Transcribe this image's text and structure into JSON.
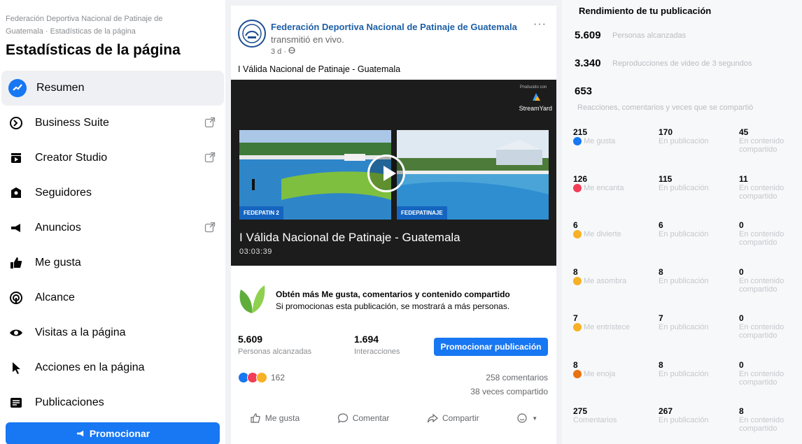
{
  "sidebar": {
    "breadcrumb": "Federación Deportiva Nacional de Patinaje de Guatemala · Estadísticas de la página",
    "title": "Estadísticas de la página",
    "items": [
      {
        "label": "Resumen",
        "icon": "chart-line-icon",
        "active": true
      },
      {
        "label": "Business Suite",
        "icon": "business-suite-icon",
        "external": true
      },
      {
        "label": "Creator Studio",
        "icon": "creator-studio-icon",
        "external": true
      },
      {
        "label": "Seguidores",
        "icon": "followers-icon"
      },
      {
        "label": "Anuncios",
        "icon": "megaphone-icon",
        "external": true
      },
      {
        "label": "Me gusta",
        "icon": "thumbs-up-icon"
      },
      {
        "label": "Alcance",
        "icon": "reach-icon"
      },
      {
        "label": "Visitas a la página",
        "icon": "eye-icon"
      },
      {
        "label": "Acciones en la página",
        "icon": "cursor-icon"
      },
      {
        "label": "Publicaciones",
        "icon": "posts-icon"
      }
    ],
    "promote_label": "Promocionar"
  },
  "post": {
    "page_name": "Federación Deportiva Nacional de Patinaje de Guatemala",
    "action": "transmitió en vivo.",
    "time": "3 d · ",
    "text": "I Válida Nacional de Patinaje - Guatemala",
    "video": {
      "produced_by": "Producido con",
      "brand": "StreamYard",
      "cam1_label": "FEDEPATIN 2",
      "cam2_label": "FEDEPATINAJE",
      "title": "I Válida Nacional de Patinaje - Guatemala",
      "duration": "03:03:39"
    },
    "promo": {
      "heading": "Obtén más Me gusta, comentarios y contenido compartido",
      "sub": "Si promocionas esta publicación, se mostrará a más personas."
    },
    "stats": {
      "reach_value": "5.609",
      "reach_label": "Personas alcanzadas",
      "inter_value": "1.694",
      "inter_label": "Interacciones"
    },
    "boost_label": "Promocionar publicación",
    "reaction_count": "162",
    "comments": "258 comentarios",
    "shares": "38 veces compartido",
    "actions": {
      "like": "Me gusta",
      "comment": "Comentar",
      "share": "Compartir"
    }
  },
  "performance": {
    "title": "Rendimiento de tu publicación",
    "reach": {
      "value": "5.609",
      "label": "Personas alcanzadas"
    },
    "views": {
      "value": "3.340",
      "label": "Reproducciones de video de 3 segundos"
    },
    "engagement": {
      "value": "653",
      "label": "Reacciones, comentarios y veces que se compartió"
    },
    "rows": [
      {
        "total": "215",
        "label": "Me gusta",
        "color": "#1877f2",
        "on_post": "170",
        "on_post_label": "En publicación",
        "on_shared": "45",
        "on_shared_label": "En contenido compartido"
      },
      {
        "total": "126",
        "label": "Me encanta",
        "color": "#f33e58",
        "on_post": "115",
        "on_post_label": "En publicación",
        "on_shared": "11",
        "on_shared_label": "En contenido compartido"
      },
      {
        "total": "6",
        "label": "Me divierte",
        "color": "#f7b125",
        "on_post": "6",
        "on_post_label": "En publicación",
        "on_shared": "0",
        "on_shared_label": "En contenido compartido"
      },
      {
        "total": "8",
        "label": "Me asombra",
        "color": "#f7b125",
        "on_post": "8",
        "on_post_label": "En publicación",
        "on_shared": "0",
        "on_shared_label": "En contenido compartido"
      },
      {
        "total": "7",
        "label": "Me entristece",
        "color": "#f7b125",
        "on_post": "7",
        "on_post_label": "En publicación",
        "on_shared": "0",
        "on_shared_label": "En contenido compartido"
      },
      {
        "total": "8",
        "label": "Me enoja",
        "color": "#e9710f",
        "on_post": "8",
        "on_post_label": "En publicación",
        "on_shared": "0",
        "on_shared_label": "En contenido compartido"
      },
      {
        "total": "275",
        "label": "Comentarios",
        "color": "",
        "on_post": "267",
        "on_post_label": "En publicación",
        "on_shared": "8",
        "on_shared_label": "En contenido compartido"
      }
    ]
  },
  "colors": {
    "accent": "#1877f2",
    "page_link": "#1d5fa6"
  }
}
